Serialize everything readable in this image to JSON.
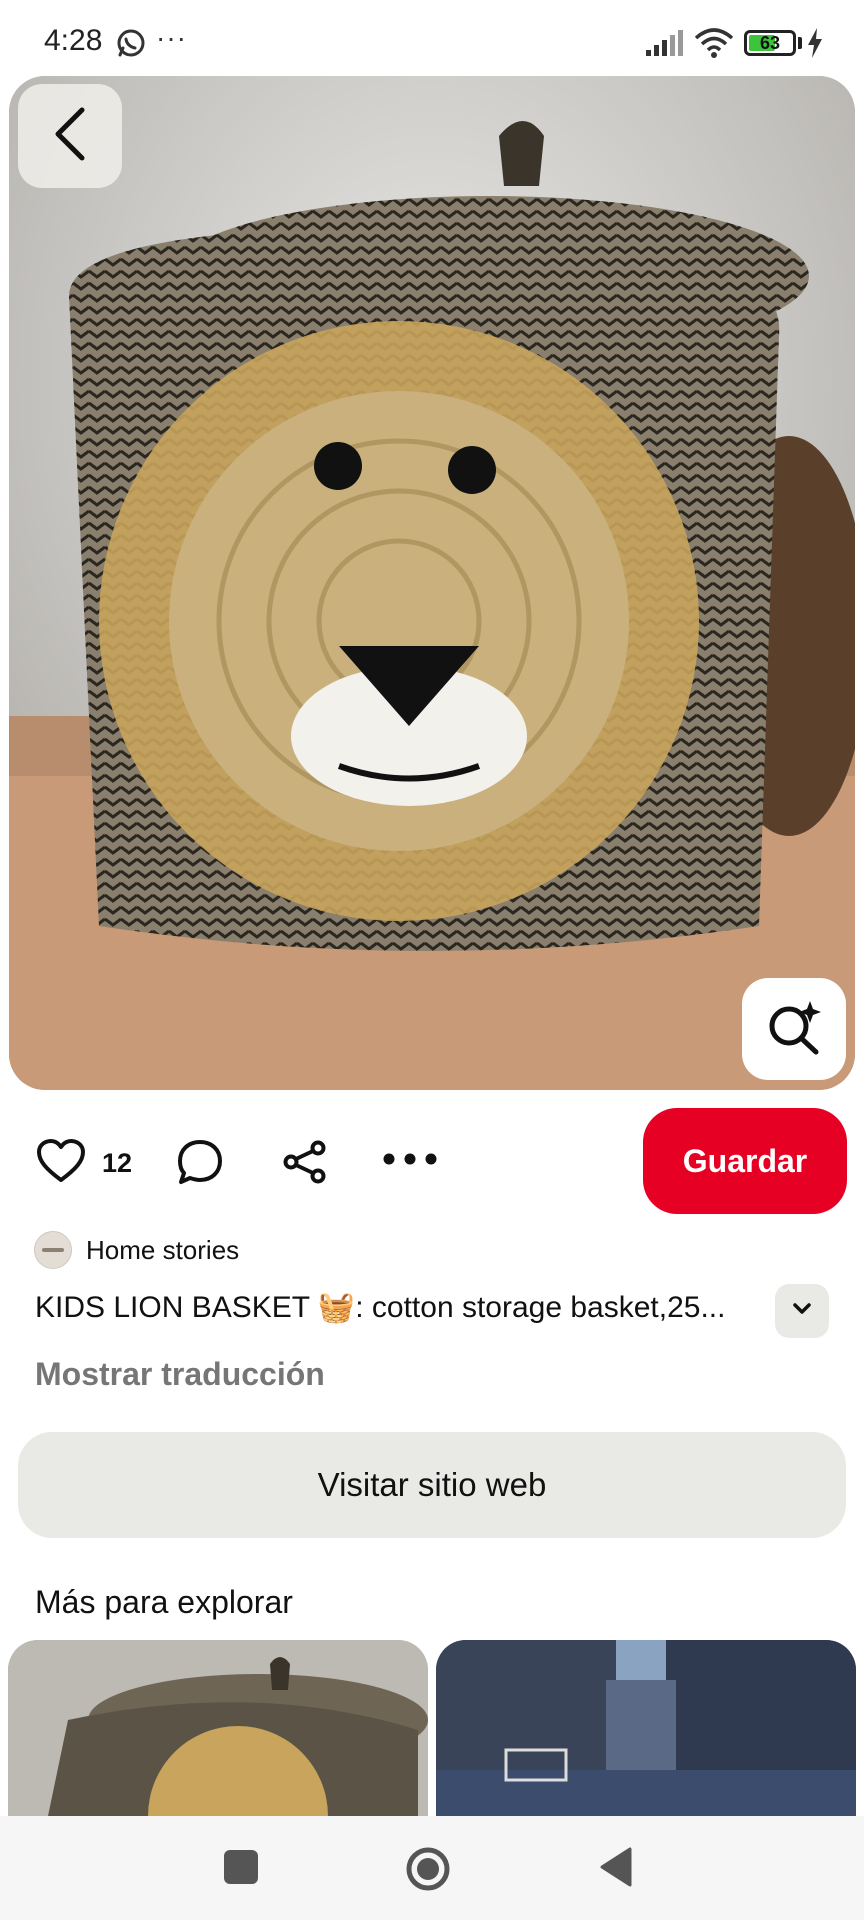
{
  "status_bar": {
    "time": "4:28",
    "dots": "···",
    "battery_level": 63,
    "battery_text": "63",
    "icons": [
      "whatsapp-icon",
      "signal-icon",
      "wifi-icon",
      "battery-icon",
      "charging-icon"
    ]
  },
  "hero": {
    "icons": [
      "back-arrow-icon",
      "visual-search-sparkle-icon"
    ]
  },
  "actions": {
    "like_count": "12",
    "save_label": "Guardar",
    "save_color": "#e60023",
    "icons": [
      "heart-icon",
      "comment-icon",
      "share-icon",
      "more-icon"
    ]
  },
  "author": {
    "name": "Home stories"
  },
  "pin": {
    "title": "KIDS LION BASKET 🧺: cotton storage basket,25...",
    "translate_label": "Mostrar traducción",
    "visit_label": "Visitar sitio web"
  },
  "explore": {
    "title": "Más para explorar",
    "thumbnails": [
      "lion-basket-thumbnail",
      "city-street-thumbnail"
    ]
  },
  "nav_bar": {
    "icons": [
      "recents-square-icon",
      "home-circle-icon",
      "back-triangle-icon"
    ]
  }
}
